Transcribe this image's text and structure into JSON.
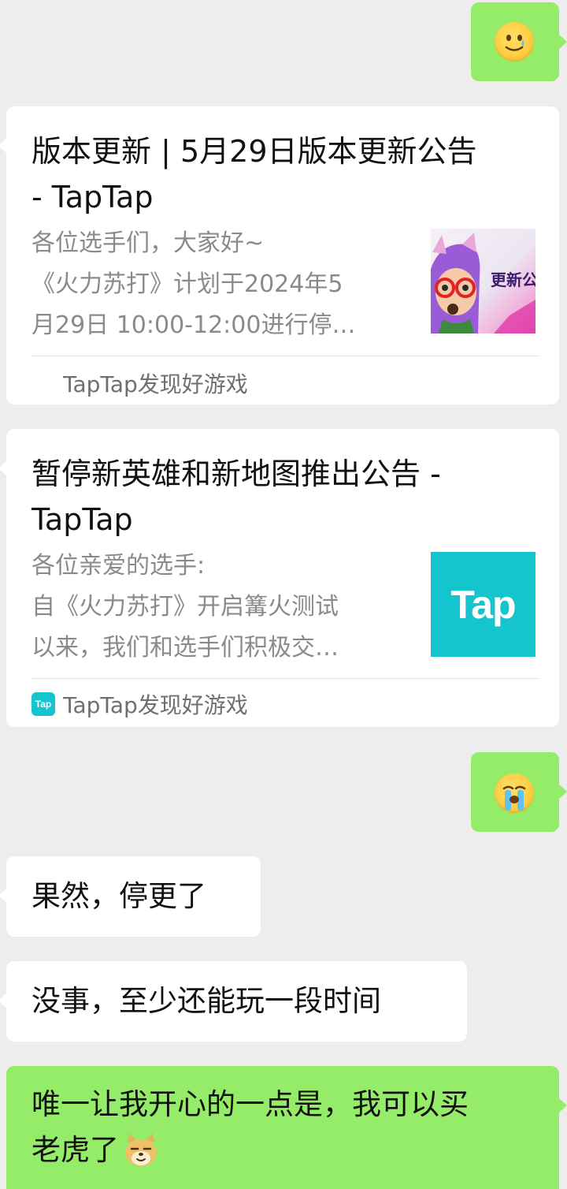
{
  "messages": [
    {
      "id": "m1",
      "side": "right",
      "type": "emoji",
      "emoji": "smiling-face-with-tear-icon"
    },
    {
      "id": "m2",
      "side": "left",
      "type": "link-card",
      "title_lines": [
        "版本更新 | 5月29日版本更新公告",
        "- TapTap"
      ],
      "desc_lines": [
        "各位选手们，大家好~",
        "《火力苏打》计划于2024年5",
        "月29日 10:00-12:00进行停…"
      ],
      "thumb_caption": "更新公",
      "thumb_icon": "game-character-thumbnail",
      "source": "TapTap发现好游戏"
    },
    {
      "id": "m3",
      "side": "left",
      "type": "link-card",
      "title_lines": [
        "暂停新英雄和新地图推出公告 -",
        "TapTap"
      ],
      "desc_lines": [
        "各位亲爱的选手:",
        "自《火力苏打》开启篝火测试",
        "以来，我们和选手们积极交…"
      ],
      "thumb_text": "Tap",
      "source_icon_text": "Tap",
      "source": "TapTap发现好游戏"
    },
    {
      "id": "m4",
      "side": "right",
      "type": "emoji",
      "emoji": "loudly-crying-face-icon"
    },
    {
      "id": "m5",
      "side": "left",
      "type": "text",
      "text": "果然，停更了"
    },
    {
      "id": "m6",
      "side": "left",
      "type": "text",
      "text": "没事，至少还能玩一段时间"
    },
    {
      "id": "m7",
      "side": "right",
      "type": "text",
      "lines": [
        "唯一让我开心的一点是，我可以买",
        "老虎了"
      ],
      "trailing_emoji": "doge-icon"
    }
  ],
  "colors": {
    "background": "#ededed",
    "bubble_self": "#95ec69",
    "bubble_other": "#ffffff",
    "tap_brand": "#15c5ce"
  }
}
